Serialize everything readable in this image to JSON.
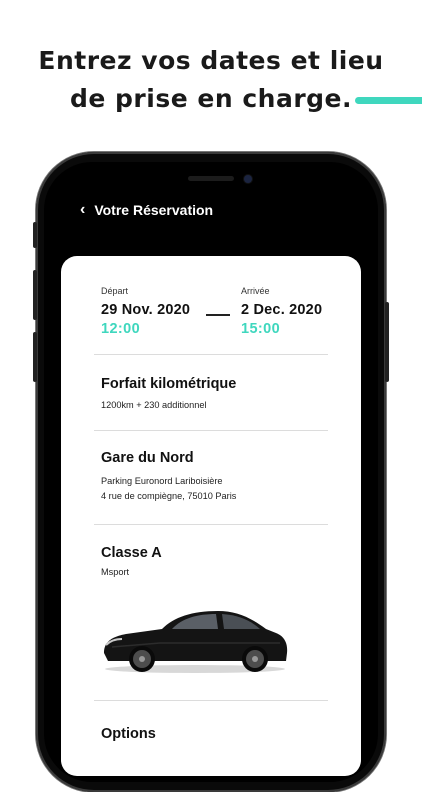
{
  "headline": {
    "line1": "Entrez vos dates et lieu",
    "line2": "de prise en charge."
  },
  "colors": {
    "accent": "#3fd7be",
    "phone": "#0a0a0a"
  },
  "navbar": {
    "back_icon": "chevron-left-icon",
    "title": "Votre Réservation"
  },
  "booking": {
    "departure": {
      "label": "Départ",
      "date": "29 Nov. 2020",
      "time": "12:00"
    },
    "arrival": {
      "label": "Arrivée",
      "date": "2 Dec. 2020",
      "time": "15:00"
    }
  },
  "mileage": {
    "title": "Forfait kilométrique",
    "detail": "1200km + 230 additionnel"
  },
  "location": {
    "title": "Gare du Nord",
    "parking": "Parking Euronord Lariboisière",
    "address": "4 rue de compiègne, 75010 Paris"
  },
  "vehicle": {
    "title": "Classe A",
    "trim": "Msport",
    "image": "black-sedan-image"
  },
  "options": {
    "title": "Options"
  }
}
